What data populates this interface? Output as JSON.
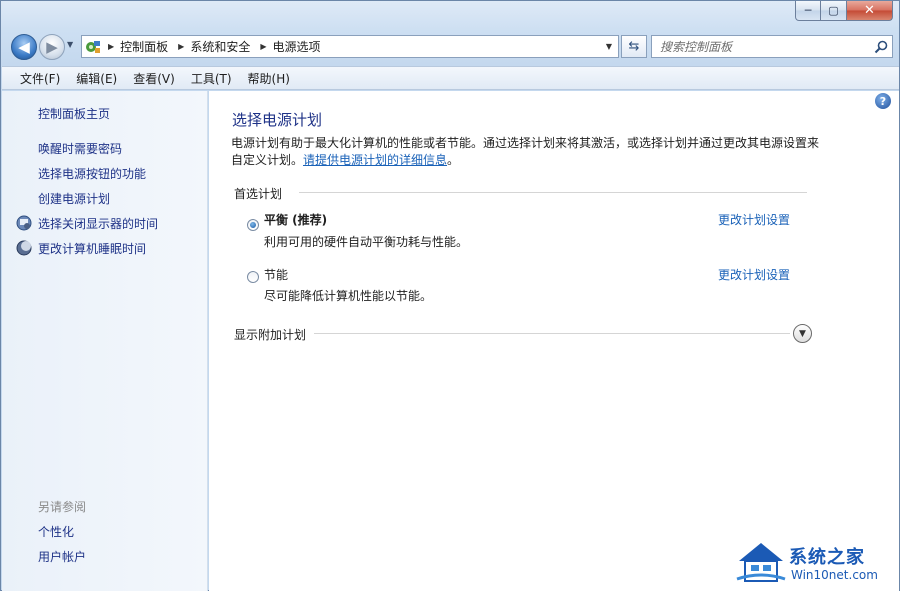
{
  "window": {
    "caption": {
      "minimize": "─",
      "maximize": "▢",
      "close": "✕"
    }
  },
  "nav": {
    "back_glyph": "◀",
    "forward_glyph": "▶",
    "history_drop": "▼",
    "breadcrumb": [
      "控制面板",
      "系统和安全",
      "电源选项"
    ],
    "crumb_sep": "▶",
    "address_drop": "▼",
    "refresh_glyph": "⇆",
    "search_placeholder": "搜索控制面板"
  },
  "menu": [
    "文件(F)",
    "编辑(E)",
    "查看(V)",
    "工具(T)",
    "帮助(H)"
  ],
  "sidebar": {
    "home": "控制面板主页",
    "links": [
      "唤醒时需要密码",
      "选择电源按钮的功能",
      "创建电源计划",
      "选择关闭显示器的时间",
      "更改计算机睡眠时间"
    ],
    "see_also": "另请参阅",
    "see_also_links": [
      "个性化",
      "用户帐户"
    ]
  },
  "main": {
    "help_glyph": "?",
    "title": "选择电源计划",
    "description": "电源计划有助于最大化计算机的性能或者节能。通过选择计划来将其激活，或选择计划并通过更改其电源设置来自定义计划。",
    "description_link": "请提供电源计划的详细信息",
    "description_end": "。",
    "group_label": "首选计划",
    "plans": [
      {
        "name": "平衡 (推荐)",
        "desc": "利用可用的硬件自动平衡功耗与性能。",
        "link": "更改计划设置",
        "selected": true
      },
      {
        "name": "节能",
        "desc": "尽可能降低计算机性能以节能。",
        "link": "更改计划设置",
        "selected": false
      }
    ],
    "more_label": "显示附加计划",
    "expand_glyph": "▼"
  },
  "watermark": {
    "title": "系统之家",
    "url": "Win10net.com"
  },
  "colors": {
    "link": "#1a62b8",
    "heading": "#1e3287",
    "accent": "#1b5ab5"
  }
}
